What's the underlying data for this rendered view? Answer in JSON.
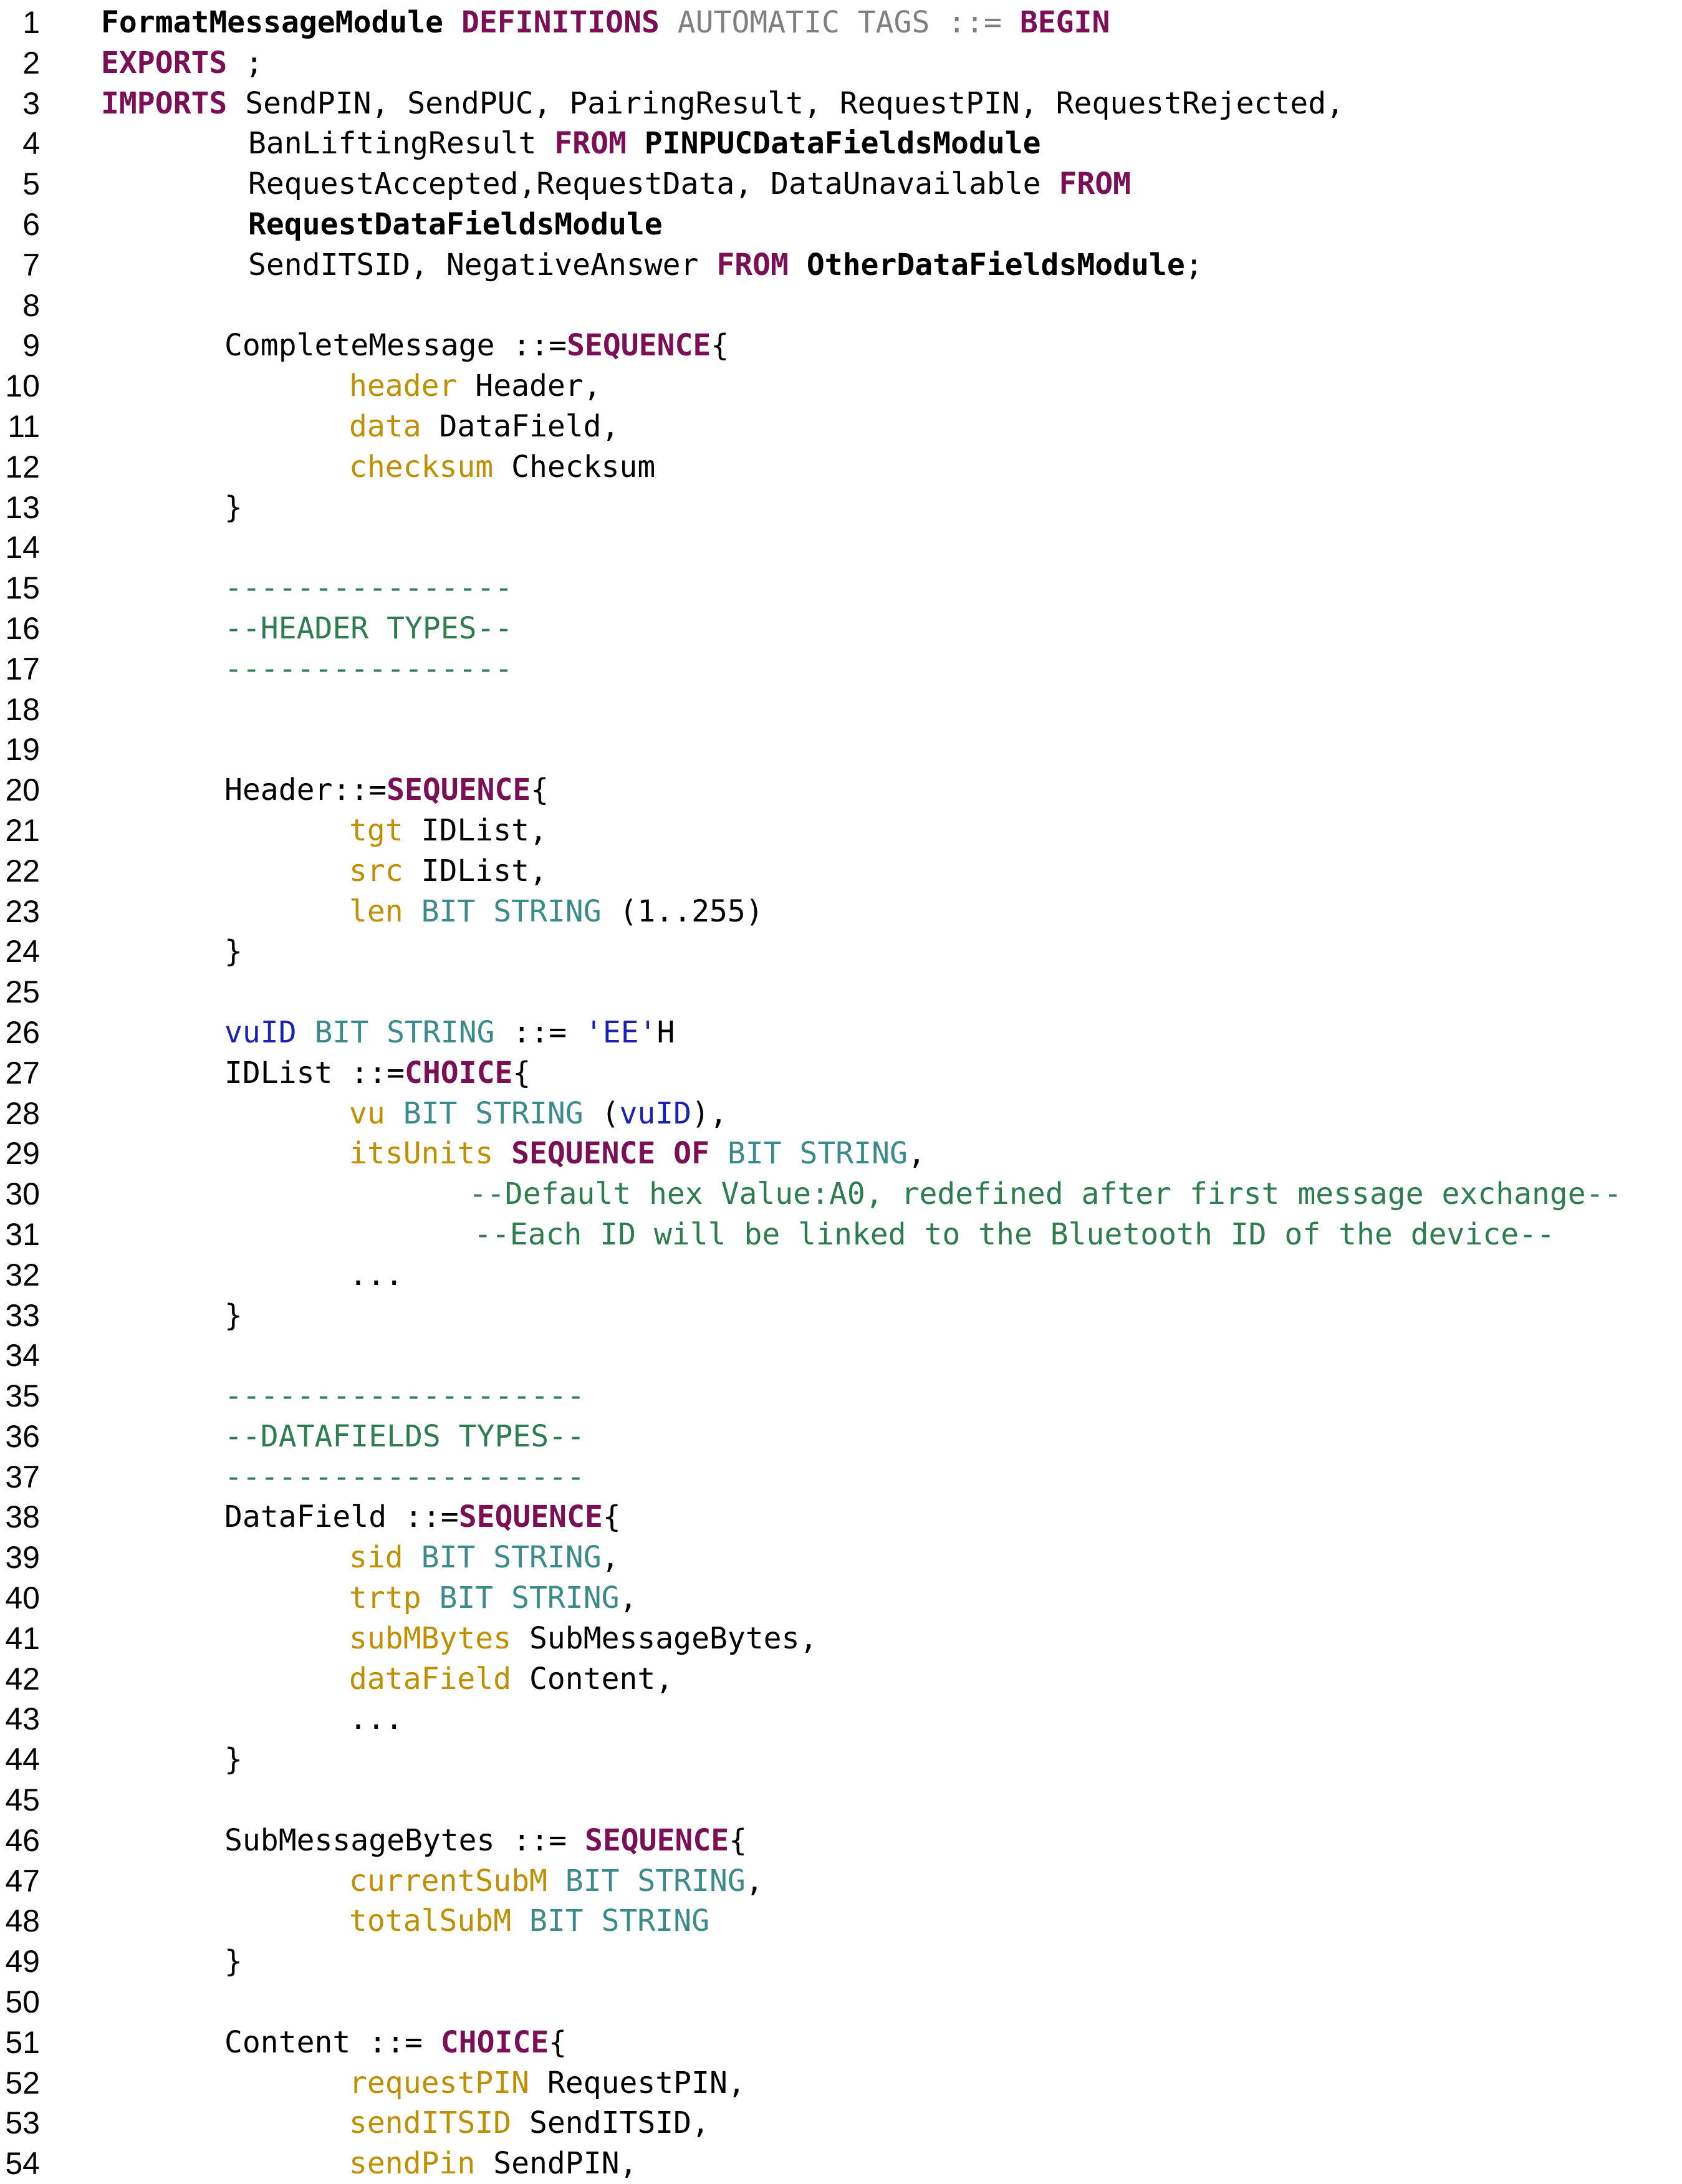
{
  "lines": [
    {
      "n": "1",
      "i": 1,
      "t": [
        [
          "FormatMessageModule",
          "bold"
        ],
        [
          " ",
          "plain"
        ],
        [
          "DEFINITIONS",
          "kw"
        ],
        [
          " AUTOMATIC TAGS ::= ",
          "gray"
        ],
        [
          "BEGIN",
          "kw"
        ]
      ]
    },
    {
      "n": "2",
      "i": 1,
      "t": [
        [
          "EXPORTS",
          "kw"
        ],
        [
          " ;",
          "plain"
        ]
      ]
    },
    {
      "n": "3",
      "i": 1,
      "t": [
        [
          "IMPORTS",
          "kw"
        ],
        [
          " SendPIN, SendPUC, PairingResult, RequestPIN, RequestRejected,",
          "plain"
        ]
      ]
    },
    {
      "n": "4",
      "i": 2,
      "t": [
        [
          "BanLiftingResult ",
          "plain"
        ],
        [
          "FROM",
          "kw"
        ],
        [
          " ",
          "plain"
        ],
        [
          "PINPUCDataFieldsModule",
          "bold"
        ]
      ]
    },
    {
      "n": "5",
      "i": 2,
      "t": [
        [
          "RequestAccepted,RequestData, DataUnavailable ",
          "plain"
        ],
        [
          "FROM",
          "kw"
        ]
      ]
    },
    {
      "n": "6",
      "i": 2,
      "t": [
        [
          "RequestDataFieldsModule",
          "bold"
        ]
      ]
    },
    {
      "n": "7",
      "i": 2,
      "t": [
        [
          "SendITSID, NegativeAnswer ",
          "plain"
        ],
        [
          "FROM",
          "kw"
        ],
        [
          " ",
          "plain"
        ],
        [
          "OtherDataFieldsModule",
          "bold"
        ],
        [
          ";",
          "plain"
        ]
      ]
    },
    {
      "n": "8",
      "i": 0,
      "t": []
    },
    {
      "n": "9",
      "i": 3,
      "t": [
        [
          "CompleteMessage ::=",
          "plain"
        ],
        [
          "SEQUENCE",
          "kw"
        ],
        [
          "{",
          "plain"
        ]
      ]
    },
    {
      "n": "10",
      "i": 4,
      "t": [
        [
          "header",
          "field"
        ],
        [
          " Header,",
          "plain"
        ]
      ]
    },
    {
      "n": "11",
      "i": 4,
      "t": [
        [
          "data",
          "field"
        ],
        [
          " DataField,",
          "plain"
        ]
      ]
    },
    {
      "n": "12",
      "i": 4,
      "t": [
        [
          "checksum",
          "field"
        ],
        [
          " Checksum",
          "plain"
        ]
      ]
    },
    {
      "n": "13",
      "i": 3,
      "t": [
        [
          "}",
          "plain"
        ]
      ]
    },
    {
      "n": "14",
      "i": 0,
      "t": []
    },
    {
      "n": "15",
      "i": 3,
      "t": [
        [
          "----------------",
          "comment"
        ]
      ]
    },
    {
      "n": "16",
      "i": 3,
      "t": [
        [
          "--HEADER TYPES--",
          "comment"
        ]
      ]
    },
    {
      "n": "17",
      "i": 3,
      "t": [
        [
          "----------------",
          "comment"
        ]
      ]
    },
    {
      "n": "18",
      "i": 0,
      "t": []
    },
    {
      "n": "19",
      "i": 0,
      "t": []
    },
    {
      "n": "20",
      "i": 3,
      "t": [
        [
          "Header::=",
          "plain"
        ],
        [
          "SEQUENCE",
          "kw"
        ],
        [
          "{",
          "plain"
        ]
      ]
    },
    {
      "n": "21",
      "i": 4,
      "t": [
        [
          "tgt",
          "field"
        ],
        [
          " IDList,",
          "plain"
        ]
      ]
    },
    {
      "n": "22",
      "i": 4,
      "t": [
        [
          "src",
          "field"
        ],
        [
          " IDList,",
          "plain"
        ]
      ]
    },
    {
      "n": "23",
      "i": 4,
      "t": [
        [
          "len",
          "field"
        ],
        [
          " ",
          "plain"
        ],
        [
          "BIT STRING",
          "type"
        ],
        [
          " (1..255)",
          "plain"
        ]
      ]
    },
    {
      "n": "24",
      "i": 3,
      "t": [
        [
          "}",
          "plain"
        ]
      ]
    },
    {
      "n": "25",
      "i": 0,
      "t": []
    },
    {
      "n": "26",
      "i": 3,
      "t": [
        [
          "vuID",
          "id"
        ],
        [
          " ",
          "plain"
        ],
        [
          "BIT STRING",
          "type"
        ],
        [
          " ::= ",
          "plain"
        ],
        [
          "'EE'",
          "id"
        ],
        [
          "H",
          "plain"
        ]
      ]
    },
    {
      "n": "27",
      "i": 3,
      "t": [
        [
          "IDList ::=",
          "plain"
        ],
        [
          "CHOICE",
          "kw"
        ],
        [
          "{",
          "plain"
        ]
      ]
    },
    {
      "n": "28",
      "i": 4,
      "t": [
        [
          "vu",
          "field"
        ],
        [
          " ",
          "plain"
        ],
        [
          "BIT STRING",
          "type"
        ],
        [
          " (",
          "plain"
        ],
        [
          "vuID",
          "id"
        ],
        [
          "),",
          "plain"
        ]
      ]
    },
    {
      "n": "29",
      "i": 4,
      "t": [
        [
          "itsUnits",
          "field"
        ],
        [
          " ",
          "plain"
        ],
        [
          "SEQUENCE OF",
          "kw"
        ],
        [
          " ",
          "plain"
        ],
        [
          "BIT STRING",
          "type"
        ],
        [
          ",",
          "plain"
        ]
      ]
    },
    {
      "n": "30",
      "i": 5,
      "t": [
        [
          "--Default hex Value:A0, redefined after first message exchange--",
          "comment"
        ]
      ]
    },
    {
      "n": "31",
      "i": 6,
      "t": [
        [
          "--Each ID will be linked to the Bluetooth ID of the device--",
          "comment"
        ]
      ]
    },
    {
      "n": "32",
      "i": 4,
      "t": [
        [
          "...",
          "plain"
        ]
      ]
    },
    {
      "n": "33",
      "i": 3,
      "t": [
        [
          "}",
          "plain"
        ]
      ]
    },
    {
      "n": "34",
      "i": 0,
      "t": []
    },
    {
      "n": "35",
      "i": 3,
      "t": [
        [
          "--------------------",
          "comment"
        ]
      ]
    },
    {
      "n": "36",
      "i": 3,
      "t": [
        [
          "--DATAFIELDS TYPES--",
          "comment"
        ]
      ]
    },
    {
      "n": "37",
      "i": 3,
      "t": [
        [
          "--------------------",
          "comment"
        ]
      ]
    },
    {
      "n": "38",
      "i": 3,
      "t": [
        [
          "DataField ::=",
          "plain"
        ],
        [
          "SEQUENCE",
          "kw"
        ],
        [
          "{",
          "plain"
        ]
      ]
    },
    {
      "n": "39",
      "i": 4,
      "t": [
        [
          "sid",
          "field"
        ],
        [
          " ",
          "plain"
        ],
        [
          "BIT STRING",
          "type"
        ],
        [
          ",",
          "plain"
        ]
      ]
    },
    {
      "n": "40",
      "i": 4,
      "t": [
        [
          "trtp",
          "field"
        ],
        [
          " ",
          "plain"
        ],
        [
          "BIT STRING",
          "type"
        ],
        [
          ",",
          "plain"
        ]
      ]
    },
    {
      "n": "41",
      "i": 4,
      "t": [
        [
          "subMBytes",
          "field"
        ],
        [
          " SubMessageBytes,",
          "plain"
        ]
      ]
    },
    {
      "n": "42",
      "i": 4,
      "t": [
        [
          "dataField",
          "field"
        ],
        [
          " Content,",
          "plain"
        ]
      ]
    },
    {
      "n": "43",
      "i": 4,
      "t": [
        [
          "...",
          "plain"
        ]
      ]
    },
    {
      "n": "44",
      "i": 3,
      "t": [
        [
          "}",
          "plain"
        ]
      ]
    },
    {
      "n": "45",
      "i": 0,
      "t": []
    },
    {
      "n": "46",
      "i": 3,
      "t": [
        [
          "SubMessageBytes ::= ",
          "plain"
        ],
        [
          "SEQUENCE",
          "kw"
        ],
        [
          "{",
          "plain"
        ]
      ]
    },
    {
      "n": "47",
      "i": 4,
      "t": [
        [
          "currentSubM",
          "field"
        ],
        [
          " ",
          "plain"
        ],
        [
          "BIT STRING",
          "type"
        ],
        [
          ",",
          "plain"
        ]
      ]
    },
    {
      "n": "48",
      "i": 4,
      "t": [
        [
          "totalSubM",
          "field"
        ],
        [
          " ",
          "plain"
        ],
        [
          "BIT STRING",
          "type"
        ]
      ]
    },
    {
      "n": "49",
      "i": 3,
      "t": [
        [
          "}",
          "plain"
        ]
      ]
    },
    {
      "n": "50",
      "i": 0,
      "t": []
    },
    {
      "n": "51",
      "i": 3,
      "t": [
        [
          "Content ::= ",
          "plain"
        ],
        [
          "CHOICE",
          "kw"
        ],
        [
          "{",
          "plain"
        ]
      ]
    },
    {
      "n": "52",
      "i": 4,
      "t": [
        [
          "requestPIN",
          "field"
        ],
        [
          " RequestPIN,",
          "plain"
        ]
      ]
    },
    {
      "n": "53",
      "i": 4,
      "t": [
        [
          "sendITSID",
          "field"
        ],
        [
          " SendITSID,",
          "plain"
        ]
      ]
    },
    {
      "n": "54",
      "i": 4,
      "t": [
        [
          "sendPin",
          "field"
        ],
        [
          " SendPIN,",
          "plain"
        ]
      ]
    }
  ]
}
